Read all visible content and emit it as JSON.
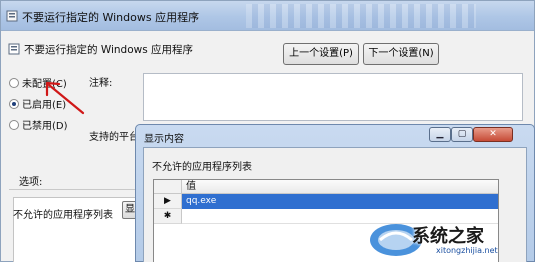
{
  "window": {
    "title": "不要运行指定的 Windows 应用程序"
  },
  "header": {
    "policy_title": "不要运行指定的 Windows 应用程序",
    "prev_button": "上一个设置(P)",
    "next_button": "下一个设置(N)"
  },
  "state_options": [
    {
      "label": "未配置(C)",
      "checked": false
    },
    {
      "label": "已启用(E)",
      "checked": true
    },
    {
      "label": "已禁用(D)",
      "checked": false
    }
  ],
  "labels": {
    "comment": "注释:",
    "supported_on": "支持的平台:",
    "options": "选项:"
  },
  "options_panel": {
    "list_label": "不允许的应用程序列表",
    "show_button": "显"
  },
  "dialog": {
    "title": "显示内容",
    "list_label": "不允许的应用程序列表",
    "column_header": "值",
    "rows": [
      {
        "marker": "▶",
        "value": "qq.exe",
        "selected": true
      },
      {
        "marker": "✱",
        "value": "",
        "selected": false
      }
    ]
  },
  "watermark": {
    "text": "系统之家",
    "url": "xitongzhijia.net"
  },
  "colors": {
    "selection": "#2f6fd0",
    "annotation_arrow": "#d01818"
  }
}
